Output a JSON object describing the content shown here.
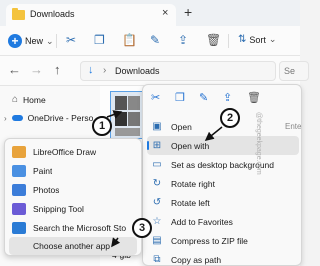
{
  "window": {
    "tab_title": "Downloads",
    "tab_close_glyph": "×",
    "new_tab_glyph": "+"
  },
  "toolbar": {
    "new_label": "New",
    "new_chevron": "⌄",
    "sort_label": "Sort",
    "sort_chevron": "⌄"
  },
  "address_bar": {
    "back_glyph": "←",
    "forward_glyph": "→",
    "up_glyph": "↑",
    "chevron": "›",
    "crumb": "Downloads",
    "search_placeholder": "Se"
  },
  "nav_pane": {
    "items": [
      {
        "label": "Home",
        "icon": "home-icon"
      },
      {
        "label": "OneDrive - Perso",
        "icon": "onedrive-icon"
      }
    ]
  },
  "context_menu": {
    "quick_icons": [
      "cut-icon",
      "copy-icon",
      "rename-icon",
      "share-icon",
      "delete-icon"
    ],
    "items": [
      {
        "label": "Open",
        "icon": "image-icon"
      },
      {
        "label": "Open with",
        "icon": "open-with-icon"
      },
      {
        "label": "Set as desktop background",
        "icon": "desktop-icon"
      },
      {
        "label": "Rotate right",
        "icon": "rotate-right-icon"
      },
      {
        "label": "Rotate left",
        "icon": "rotate-left-icon"
      },
      {
        "label": "Add to Favorites",
        "icon": "star-icon"
      },
      {
        "label": "Compress to ZIP file",
        "icon": "zip-icon"
      },
      {
        "label": "Copy as path",
        "icon": "path-icon"
      }
    ],
    "open_shortcut": "Ente"
  },
  "open_with_submenu": {
    "items": [
      {
        "label": "LibreOffice Draw",
        "icon": "libreoffice-draw-icon",
        "color": "#e8a33c"
      },
      {
        "label": "Paint",
        "icon": "paint-icon",
        "color": "#4a90e2"
      },
      {
        "label": "Photos",
        "icon": "photos-icon",
        "color": "#3c7dd9"
      },
      {
        "label": "Snipping Tool",
        "icon": "snipping-tool-icon",
        "color": "#6b5bd6"
      },
      {
        "label": "Search the Microsoft Sto",
        "icon": "store-icon",
        "color": "#2a7bd5"
      },
      {
        "label": "Choose another app",
        "icon": "",
        "color": ""
      }
    ]
  },
  "file_partial_name": "4-glb",
  "callouts": [
    "1",
    "2",
    "3"
  ],
  "watermark": "@thegeekpage.com",
  "colors": {
    "accent": "#1f7ae0",
    "highlight": "#e4e4e4"
  }
}
